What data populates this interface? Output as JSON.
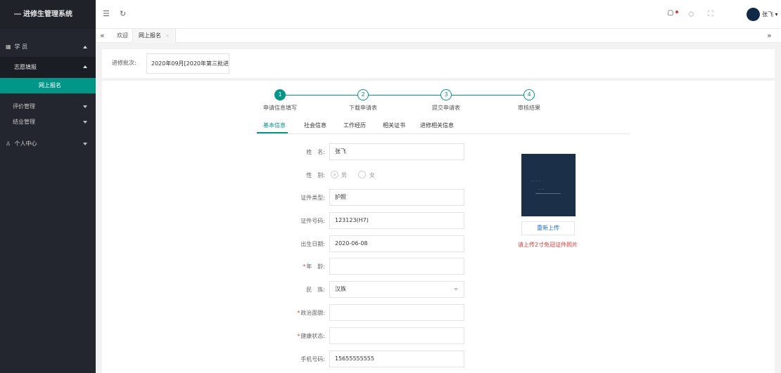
{
  "app": {
    "title": "进修生管理系统"
  },
  "sidebar": {
    "section": "学 员",
    "group": "志愿填报",
    "active_item": "网上报名",
    "items": [
      "评价管理",
      "结业管理"
    ],
    "personal": "个人中心"
  },
  "header": {
    "menu_icon": "hamburger-icon",
    "refresh_icon": "refresh-icon",
    "bell_icon": "bell-icon",
    "theme_icon": "theme-icon",
    "fullscreen_icon": "fullscreen-icon",
    "user_name": "张飞"
  },
  "tabs": {
    "home": "欢迎",
    "current": "网上报名"
  },
  "batch": {
    "label": "进修批次:",
    "value": "2020年09月[2020年第三批进"
  },
  "steps": [
    {
      "num": "1",
      "label": "申请信息填写"
    },
    {
      "num": "2",
      "label": "下载申请表"
    },
    {
      "num": "3",
      "label": "提交申请表"
    },
    {
      "num": "4",
      "label": "审核结果"
    }
  ],
  "form_tabs": [
    "基本信息",
    "社会信息",
    "工作经历",
    "相关证书",
    "进修相关信息"
  ],
  "form": {
    "name_label": "姓　名:",
    "name": "张飞",
    "gender_label": "性　别:",
    "gender_male": "男",
    "gender_female": "女",
    "id_type_label": "证件类型:",
    "id_type": "护照",
    "id_no_label": "证件号码:",
    "id_no": "123123(H7)",
    "birth_label": "出生日期:",
    "birth": "2020-06-08",
    "age_label": "年　龄:",
    "age": "",
    "ethnic_label": "民　族:",
    "ethnic": "汉族",
    "political_label": "政治面貌:",
    "political": "",
    "health_label": "健康状态:",
    "health": "",
    "phone_label": "手机号码:",
    "phone": "15655555555"
  },
  "photo": {
    "reupload": "重新上传",
    "hint": "请上传2寸免冠证件照片"
  },
  "colors": {
    "accent": "#009688",
    "sidebar": "#23262e",
    "required": "#e53935",
    "link": "#1e6fd9"
  }
}
